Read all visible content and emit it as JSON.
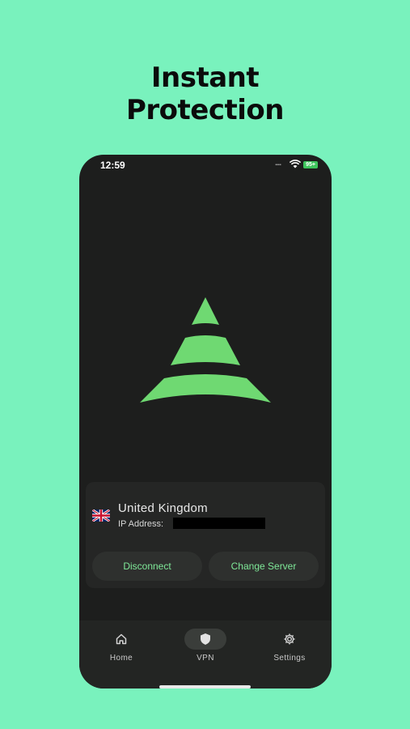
{
  "headline": {
    "line1": "Instant",
    "line2": "Protection"
  },
  "status_bar": {
    "time": "12:59",
    "signal": "....",
    "battery": "95+"
  },
  "connection": {
    "country": "United Kingdom",
    "ip_label": "IP Address:",
    "ip_value": ""
  },
  "buttons": {
    "disconnect": "Disconnect",
    "change_server": "Change Server"
  },
  "tabs": [
    {
      "label": "Home",
      "icon": "home-icon"
    },
    {
      "label": "VPN",
      "icon": "shield-icon",
      "active": true
    },
    {
      "label": "Settings",
      "icon": "gear-icon"
    }
  ],
  "colors": {
    "background": "#79f2bd",
    "phone": "#1d1e1d",
    "accent": "#6fd972",
    "button_text": "#7fe898"
  }
}
